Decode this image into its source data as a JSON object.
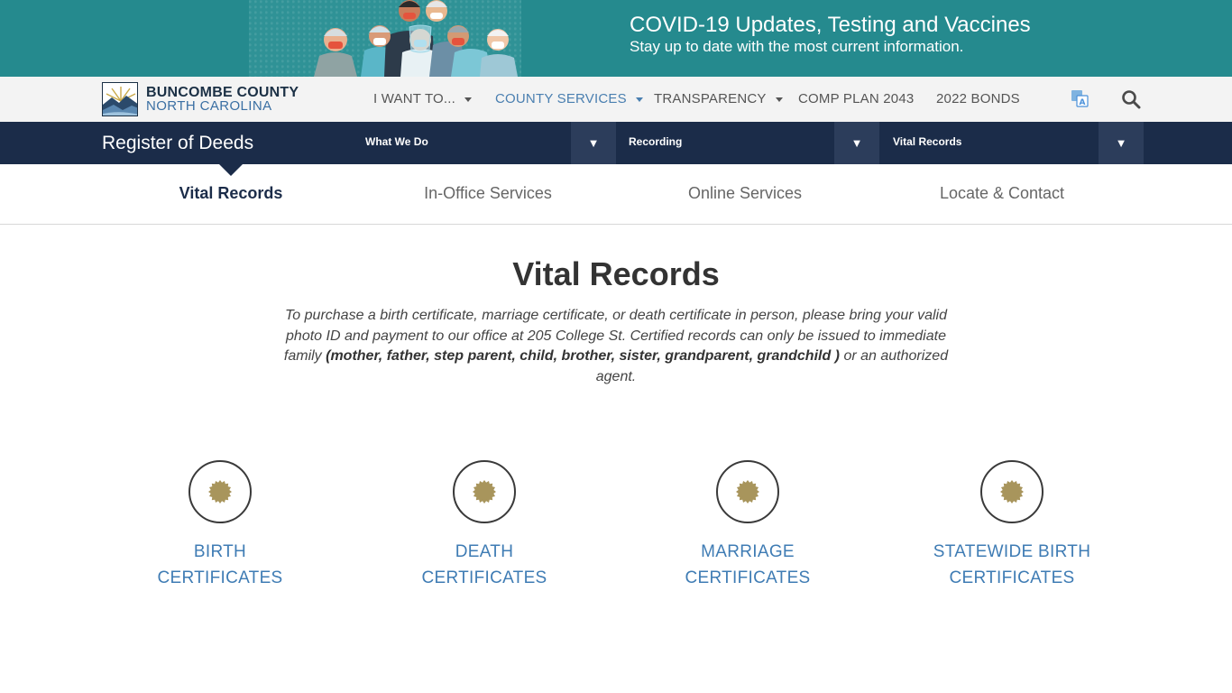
{
  "banner": {
    "title": "COVID-19 Updates, Testing and Vaccines",
    "subtitle": "Stay up to date with the most current information."
  },
  "header": {
    "logo_line1": "BUNCOMBE COUNTY",
    "logo_line2": "NORTH CAROLINA",
    "nav": [
      {
        "label": "I WANT TO...",
        "dropdown": true
      },
      {
        "label": "COUNTY SERVICES",
        "dropdown": true
      },
      {
        "label": "TRANSPARENCY",
        "dropdown": true
      },
      {
        "label": "COMP PLAN 2043",
        "dropdown": false
      },
      {
        "label": "2022 BONDS",
        "dropdown": false
      }
    ],
    "active_color": "#4a7fb0"
  },
  "department": {
    "title": "Register of Deeds",
    "selects": [
      {
        "value": "What We Do"
      },
      {
        "value": "Recording"
      },
      {
        "value": "Vital Records"
      }
    ],
    "arrow": "▼",
    "bar_color": "#1b2c49"
  },
  "tabs": [
    {
      "label": "Vital Records",
      "current": true
    },
    {
      "label": "In-Office Services",
      "current": false
    },
    {
      "label": "Online Services",
      "current": false
    },
    {
      "label": "Locate & Contact",
      "current": false
    }
  ],
  "main": {
    "title": "Vital Records",
    "intro_part1": "To purchase a birth certificate, marriage certificate, or death certificate in person, please bring your valid photo ID and payment to our office at 205 College St. Certified records can only be issued to immediate family ",
    "intro_bold": "(mother, father, step parent, child, brother, sister, grandparent, grandchild )",
    "intro_part2": " or an authorized agent."
  },
  "cards": [
    {
      "line1": "BIRTH",
      "line2": "CERTIFICATES",
      "icon": "seal-icon"
    },
    {
      "line1": "DEATH",
      "line2": "CERTIFICATES",
      "icon": "seal-icon"
    },
    {
      "line1": "MARRIAGE",
      "line2": "CERTIFICATES",
      "icon": "seal-icon"
    },
    {
      "line1": "STATEWIDE BIRTH",
      "line2": "CERTIFICATES",
      "icon": "seal-icon"
    }
  ],
  "colors": {
    "teal_banner": "#258a8e",
    "link_blue": "#3f7cb4",
    "seal_gold": "#a8955c"
  }
}
